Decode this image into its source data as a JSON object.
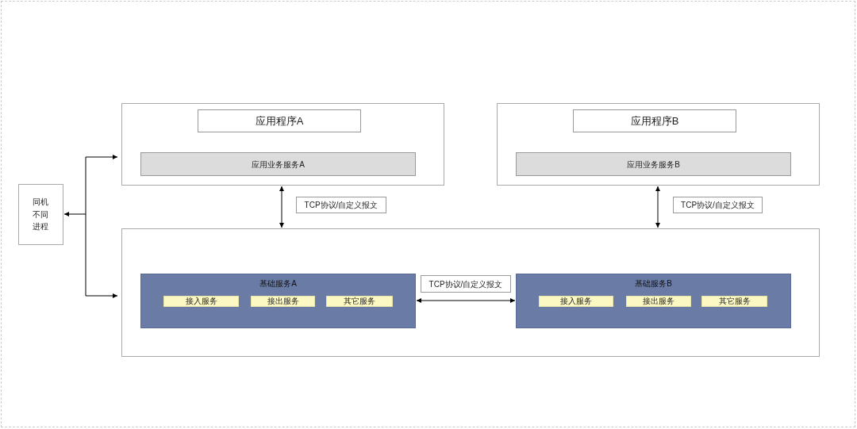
{
  "side_box": {
    "label": "同机不同进程"
  },
  "applications": [
    {
      "title": "应用程序A",
      "service": "应用业务服务A",
      "link_label": "TCP协议/自定义报文"
    },
    {
      "title": "应用程序B",
      "service": "应用业务服务B",
      "link_label": "TCP协议/自定义报文"
    }
  ],
  "base_services": [
    {
      "title": "基础服务A",
      "services": [
        "接入服务",
        "接出服务",
        "其它服务"
      ]
    },
    {
      "title": "基础服务B",
      "services": [
        "接入服务",
        "接出服务",
        "其它服务"
      ]
    }
  ],
  "middle_link_label": "TCP协议/自定义报文"
}
